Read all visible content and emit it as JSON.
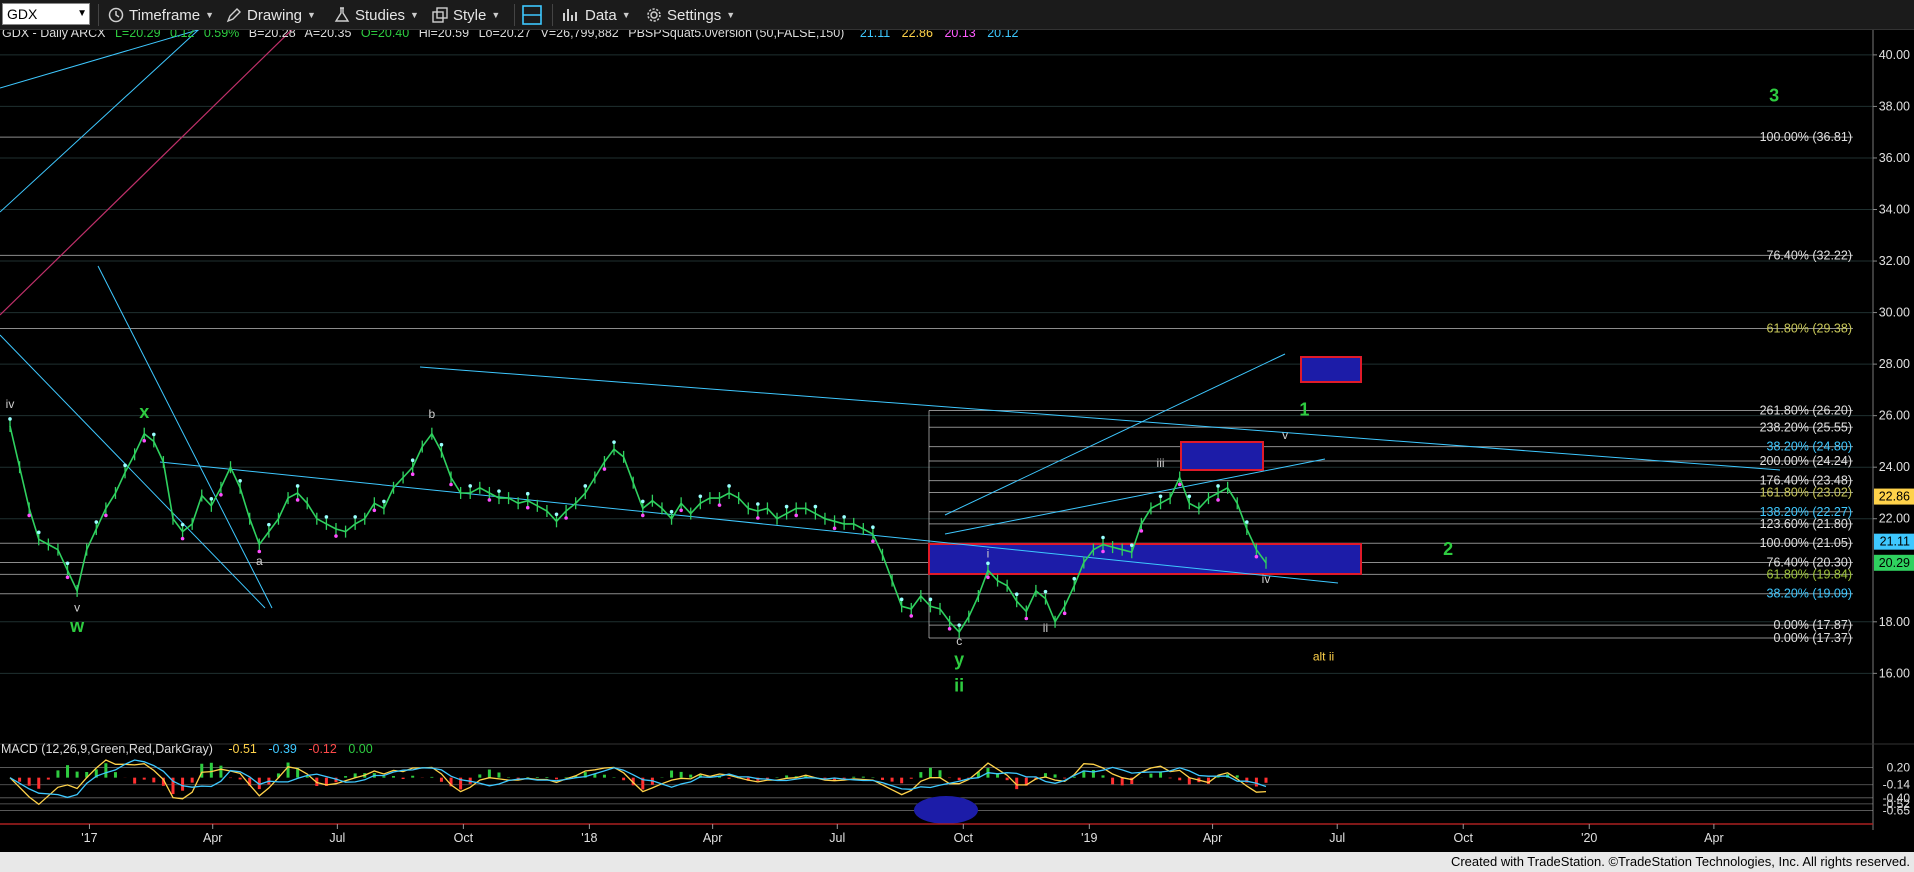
{
  "toolbar": {
    "symbol": "GDX",
    "timeframe": "Timeframe",
    "drawing": "Drawing",
    "studies": "Studies",
    "style": "Style",
    "data": "Data",
    "settings": "Settings"
  },
  "header": {
    "symbol_info": "GDX - Daily  ARCX",
    "last": "L=20.29",
    "change": "0.12",
    "change_pct": "0.59%",
    "bid": "B=20.28",
    "ask": "A=20.35",
    "open": "O=20.40",
    "high": "Hi=20.59",
    "low": "Lo=20.27",
    "volume": "V=26,799,882",
    "study_name": "PBSPSquat5.0version (50,FALSE,150)",
    "study_values": [
      "21.11",
      "22.86",
      "20.13",
      "20.12"
    ],
    "study_colors": [
      "#3ec8ff",
      "#ffd24a",
      "#ff5cff",
      "#3ec8ff"
    ]
  },
  "macd_header": {
    "label": "MACD (12,26,9,Green,Red,DarkGray)",
    "values": [
      "-0.51",
      "-0.39",
      "-0.12",
      "0.00"
    ],
    "colors": [
      "#ffd24a",
      "#3ec8ff",
      "#ff4a4a",
      "#2ecc40"
    ]
  },
  "credit": "Created with TradeStation. ©TradeStation Technologies, Inc. All rights reserved.",
  "colors": {
    "background": "#000000",
    "grid": "#1f3030",
    "price": "#2fd15f",
    "trendline": "#3ec8ff",
    "wave_label_green": "#2ecc40",
    "wave_label_yellow": "#ffd24a",
    "box_fill": "#1c1ca8",
    "box_border": "#e01a2a",
    "fib_line": "#c8c8c8"
  },
  "chart_data": {
    "type": "line",
    "title": "GDX - Daily",
    "x_ticks": [
      "'17",
      "Apr",
      "Jul",
      "Oct",
      "'18",
      "Apr",
      "Jul",
      "Oct",
      "'19",
      "Apr",
      "Jul",
      "Oct",
      "'20",
      "Apr"
    ],
    "xlim": [
      "2016-11",
      "2020-06"
    ],
    "y_ticks": [
      "40.00",
      "38.00",
      "36.00",
      "34.00",
      "32.00",
      "30.00",
      "28.00",
      "26.00",
      "24.00",
      "22.00",
      "18.00",
      "16.00"
    ],
    "ylim": [
      14.5,
      40.5
    ],
    "series": [
      {
        "dates": [
          "2016-11-04",
          "2016-11-11",
          "2016-11-18",
          "2016-11-25",
          "2016-12-02",
          "2016-12-09",
          "2016-12-16",
          "2016-12-23",
          "2016-12-30",
          "2017-01-06",
          "2017-01-13",
          "2017-01-20",
          "2017-01-27",
          "2017-02-03",
          "2017-02-10",
          "2017-02-17",
          "2017-02-24",
          "2017-03-03",
          "2017-03-10",
          "2017-03-17",
          "2017-03-24",
          "2017-03-31",
          "2017-04-07",
          "2017-04-14",
          "2017-04-21",
          "2017-04-28",
          "2017-05-05",
          "2017-05-12",
          "2017-05-19",
          "2017-05-26",
          "2017-06-02",
          "2017-06-09",
          "2017-06-16",
          "2017-06-23",
          "2017-06-30",
          "2017-07-07",
          "2017-07-14",
          "2017-07-21",
          "2017-07-28",
          "2017-08-04",
          "2017-08-11",
          "2017-08-18",
          "2017-08-25",
          "2017-09-01",
          "2017-09-08",
          "2017-09-15",
          "2017-09-22",
          "2017-09-29",
          "2017-10-06",
          "2017-10-13",
          "2017-10-20",
          "2017-10-27",
          "2017-11-03",
          "2017-11-10",
          "2017-11-17",
          "2017-11-24",
          "2017-12-01",
          "2017-12-08",
          "2017-12-15",
          "2017-12-22",
          "2017-12-29",
          "2018-01-05",
          "2018-01-12",
          "2018-01-19",
          "2018-01-26",
          "2018-02-02",
          "2018-02-09",
          "2018-02-16",
          "2018-02-23",
          "2018-03-02",
          "2018-03-09",
          "2018-03-16",
          "2018-03-23",
          "2018-03-30",
          "2018-04-06",
          "2018-04-13",
          "2018-04-20",
          "2018-04-27",
          "2018-05-04",
          "2018-05-11",
          "2018-05-18",
          "2018-05-25",
          "2018-06-01",
          "2018-06-08",
          "2018-06-15",
          "2018-06-22",
          "2018-06-29",
          "2018-07-06",
          "2018-07-13",
          "2018-07-20",
          "2018-07-27",
          "2018-08-03",
          "2018-08-10",
          "2018-08-17",
          "2018-08-24",
          "2018-08-31",
          "2018-09-07",
          "2018-09-14",
          "2018-09-21",
          "2018-09-28",
          "2018-10-05",
          "2018-10-12",
          "2018-10-19",
          "2018-10-26",
          "2018-11-02",
          "2018-11-09",
          "2018-11-16",
          "2018-11-23",
          "2018-11-30",
          "2018-12-07",
          "2018-12-14",
          "2018-12-21",
          "2018-12-28",
          "2019-01-04",
          "2019-01-11",
          "2019-01-18",
          "2019-01-25",
          "2019-02-01",
          "2019-02-08",
          "2019-02-15",
          "2019-02-22",
          "2019-03-01",
          "2019-03-08",
          "2019-03-15",
          "2019-03-22",
          "2019-03-29",
          "2019-04-05",
          "2019-04-12",
          "2019-04-19",
          "2019-04-26",
          "2019-05-03",
          "2019-05-10"
        ],
        "values": [
          25.6,
          24.0,
          22.4,
          21.2,
          21.0,
          20.8,
          20.0,
          19.2,
          20.8,
          21.6,
          22.4,
          23.0,
          23.8,
          24.5,
          25.3,
          25.0,
          24.2,
          22.0,
          21.5,
          21.8,
          22.9,
          22.5,
          23.2,
          24.0,
          23.2,
          22.0,
          21.0,
          21.5,
          22.0,
          22.8,
          23.0,
          22.6,
          22.0,
          21.8,
          21.6,
          21.5,
          21.8,
          22.0,
          22.6,
          22.4,
          23.2,
          23.6,
          24.0,
          24.8,
          25.3,
          24.6,
          23.6,
          23.0,
          23.0,
          23.2,
          23.0,
          22.8,
          22.8,
          22.6,
          22.7,
          22.5,
          22.3,
          21.9,
          22.3,
          22.6,
          23.0,
          23.6,
          24.2,
          24.7,
          24.4,
          23.4,
          22.4,
          22.7,
          22.4,
          22.0,
          22.6,
          22.2,
          22.6,
          22.8,
          22.8,
          23.0,
          22.8,
          22.4,
          22.3,
          22.4,
          22.0,
          22.2,
          22.4,
          22.4,
          22.2,
          22.0,
          21.9,
          21.8,
          21.8,
          21.6,
          21.4,
          20.6,
          19.6,
          18.6,
          18.5,
          19.0,
          18.6,
          18.5,
          18.0,
          17.6,
          18.2,
          19.0,
          20.0,
          19.6,
          19.4,
          18.8,
          18.4,
          19.2,
          18.9,
          18.0,
          18.6,
          19.4,
          20.3,
          20.8,
          21.0,
          20.9,
          20.8,
          20.7,
          21.8,
          22.4,
          22.6,
          22.8,
          23.6,
          22.6,
          22.4,
          22.8,
          23.0,
          23.2,
          22.6,
          21.6,
          20.8,
          20.29
        ]
      }
    ],
    "fib_levels": [
      {
        "label": "261.80% (26.20)",
        "value": 26.2
      },
      {
        "label": "238.20% (25.55)",
        "value": 25.55
      },
      {
        "label": "38.20% (24.80)",
        "value": 24.8
      },
      {
        "label": "200.00% (24.24)",
        "value": 24.24
      },
      {
        "label": "176.40% (23.48)",
        "value": 23.48
      },
      {
        "label": "161.80% (23.02)",
        "value": 23.02
      },
      {
        "label": "138.20% (22.27)",
        "value": 22.27
      },
      {
        "label": "123.60% (21.80)",
        "value": 21.8
      },
      {
        "label": "100.00% (21.05)",
        "value": 21.05
      },
      {
        "label": "76.40% (20.30)",
        "value": 20.3
      },
      {
        "label": "61.80% (19.84)",
        "value": 19.84
      },
      {
        "label": "38.20% (19.09)",
        "value": 19.09
      },
      {
        "label": "0.00% (17.87)",
        "value": 17.87
      },
      {
        "label": "0.00% (17.37)",
        "value": 17.37
      },
      {
        "label": "100.00% (36.81)",
        "value": 36.81
      },
      {
        "label": "76.40% (32.22)",
        "value": 32.22
      },
      {
        "label": "61.80% (29.38)",
        "value": 29.38
      }
    ],
    "price_tags": [
      {
        "label": "22.86",
        "value": 22.86,
        "color": "#ffd24a"
      },
      {
        "label": "21.11",
        "value": 21.11,
        "color": "#3ec8ff"
      },
      {
        "label": "20.29",
        "value": 20.29,
        "color": "#2fd15f"
      }
    ],
    "wave_labels": [
      {
        "text": "iv",
        "date": "2016-11-04",
        "value": 26.3,
        "color": "#cfcfcf"
      },
      {
        "text": "x",
        "date": "2017-02-10",
        "value": 25.9,
        "color": "#2ecc40"
      },
      {
        "text": "b",
        "date": "2017-09-08",
        "value": 25.9,
        "color": "#cfcfcf"
      },
      {
        "text": "a",
        "date": "2017-05-05",
        "value": 20.2,
        "color": "#cfcfcf"
      },
      {
        "text": "v",
        "date": "2016-12-23",
        "value": 18.4,
        "color": "#cfcfcf"
      },
      {
        "text": "w",
        "date": "2016-12-23",
        "value": 17.6,
        "color": "#2ecc40"
      },
      {
        "text": "i",
        "date": "2018-10-19",
        "value": 20.5,
        "color": "#cfcfcf"
      },
      {
        "text": "ii",
        "date": "2018-11-30",
        "value": 17.6,
        "color": "#cfcfcf"
      },
      {
        "text": "iii",
        "date": "2019-02-22",
        "value": 24.0,
        "color": "#cfcfcf"
      },
      {
        "text": "iv",
        "date": "2019-05-10",
        "value": 19.5,
        "color": "#cfcfcf"
      },
      {
        "text": "c",
        "date": "2018-09-28",
        "value": 17.1,
        "color": "#cfcfcf"
      },
      {
        "text": "y",
        "date": "2018-09-28",
        "value": 16.3,
        "color": "#2ecc40"
      },
      {
        "text": "ii",
        "date": "2018-09-28",
        "value": 15.3,
        "color": "#2ecc40"
      },
      {
        "text": "1",
        "date": "2019-06-07",
        "value": 26.0,
        "color": "#2ecc40"
      },
      {
        "text": "v",
        "date": "2019-05-24",
        "value": 25.1,
        "color": "#cfcfcf"
      },
      {
        "text": "2",
        "date": "2019-09-20",
        "value": 20.6,
        "color": "#2ecc40"
      },
      {
        "text": "3",
        "date": "2020-05-15",
        "value": 38.2,
        "color": "#2ecc40"
      },
      {
        "text": "alt ii",
        "date": "2019-06-21",
        "value": 16.5,
        "color": "#ffd24a"
      }
    ],
    "macd": {
      "y_ticks": [
        "0.20",
        "-0.14",
        "-0.40",
        "-0.52",
        "-0.65"
      ],
      "ylim": [
        -0.8,
        0.35
      ]
    }
  }
}
